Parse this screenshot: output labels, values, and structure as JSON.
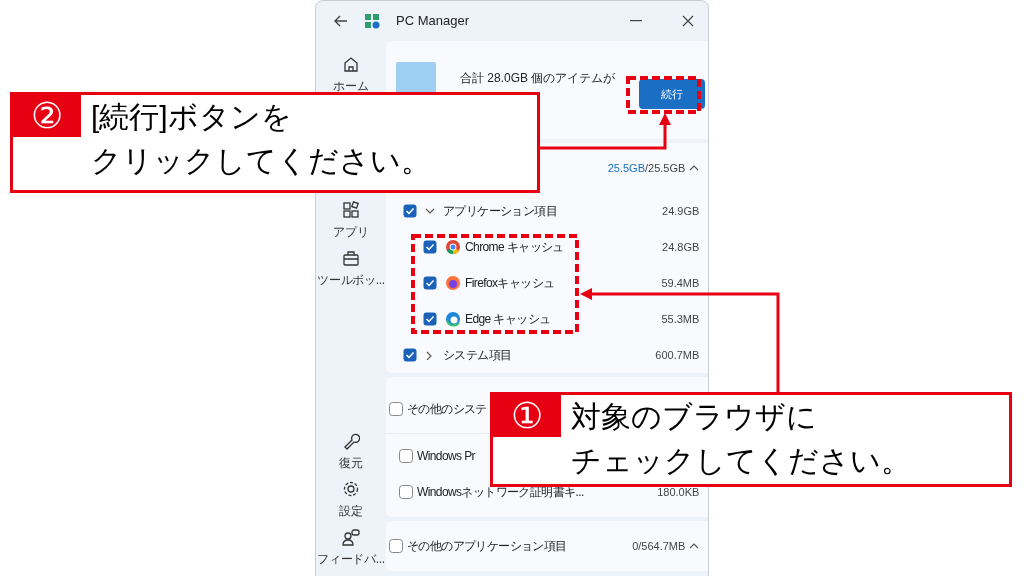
{
  "window": {
    "title": "PC Manager"
  },
  "sidebar": {
    "top_items": [
      {
        "label": "ホーム",
        "kind": "home"
      },
      {
        "label": "アプリ",
        "kind": "apps"
      },
      {
        "label": "ツールボッ...",
        "kind": "toolbox"
      }
    ],
    "bottom_items": [
      {
        "label": "復元",
        "kind": "wrench"
      },
      {
        "label": "設定",
        "kind": "gear"
      },
      {
        "label": "フィードバ...",
        "kind": "feedback"
      }
    ]
  },
  "summary": {
    "text": "合計 28.0GB 個のアイテムが",
    "action": "続行"
  },
  "sections": [
    {
      "size_selected": "25.5GB",
      "size_total": "/25.5GB",
      "expanded": true,
      "items": [
        {
          "label": "アプリケーション項目",
          "size": "24.9GB",
          "checked": true,
          "expanded": true,
          "children": [
            {
              "label": "Chrome キャッシュ",
              "size": "24.8GB",
              "checked": true,
              "kind": "chrome"
            },
            {
              "label": "Firefoxキャッシュ",
              "size": "59.4MB",
              "checked": true,
              "kind": "firefox"
            },
            {
              "label": "Edge キャッシュ",
              "size": "55.3MB",
              "checked": true,
              "kind": "edge"
            }
          ]
        },
        {
          "label": "システム項目",
          "size": "600.7MB",
          "checked": true,
          "expanded": false
        }
      ]
    },
    {
      "title": "その他のシステ",
      "checked": false,
      "items": [
        {
          "label": "Windows Pr",
          "checked": false
        },
        {
          "label": "Windowsネットワーク証明書キ...",
          "size": "180.0KB",
          "checked": false
        }
      ]
    },
    {
      "title": "その他のアプリケーション項目",
      "size_total": "0/564.7MB",
      "checked": false,
      "expanded": true
    }
  ],
  "callouts": [
    {
      "number": "②",
      "lines": [
        "[続行]ボタンを",
        "クリックしてください。"
      ]
    },
    {
      "number": "①",
      "lines": [
        "対象のブラウザに",
        "チェックしてください。"
      ]
    }
  ]
}
